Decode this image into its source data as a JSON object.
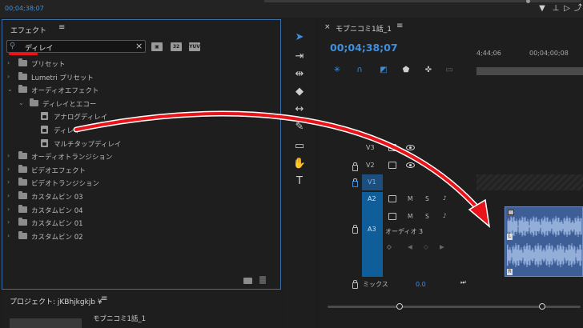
{
  "top": {
    "timecode": "00;04;38;07"
  },
  "effects": {
    "title": "エフェクト",
    "menu": "≡",
    "search_value": "ディレイ",
    "tree": [
      {
        "label": "プリセット",
        "level": 0,
        "kind": "folder",
        "expanded": false
      },
      {
        "label": "Lumetri プリセット",
        "level": 0,
        "kind": "folder",
        "expanded": false
      },
      {
        "label": "オーディオエフェクト",
        "level": 0,
        "kind": "folder",
        "expanded": true
      },
      {
        "label": "ディレイとエコー",
        "level": 1,
        "kind": "folder",
        "expanded": true
      },
      {
        "label": "アナログディレイ",
        "level": 2,
        "kind": "effect"
      },
      {
        "label": "ディレイ",
        "level": 2,
        "kind": "effect"
      },
      {
        "label": "マルチタップディレイ",
        "level": 2,
        "kind": "effect"
      },
      {
        "label": "オーディオトランジション",
        "level": 0,
        "kind": "folder",
        "expanded": false
      },
      {
        "label": "ビデオエフェクト",
        "level": 0,
        "kind": "folder",
        "expanded": false
      },
      {
        "label": "ビデオトランジション",
        "level": 0,
        "kind": "folder",
        "expanded": false
      },
      {
        "label": "カスタムビン 03",
        "level": 0,
        "kind": "folder",
        "expanded": false
      },
      {
        "label": "カスタムビン 04",
        "level": 0,
        "kind": "folder",
        "expanded": false
      },
      {
        "label": "カスタムビン 01",
        "level": 0,
        "kind": "folder",
        "expanded": false
      },
      {
        "label": "カスタムビン 02",
        "level": 0,
        "kind": "folder",
        "expanded": false
      }
    ]
  },
  "project": {
    "title": "プロジェクト: jKBhjkgkjb ¥",
    "menu": "≡",
    "item": "モブニコミ1話_1"
  },
  "timeline": {
    "close": "×",
    "title": "モブニコミ1話_1",
    "menu": "≡",
    "timecode": "00;04;38;07",
    "ruler_left": "4;44;06",
    "ruler_right": "00;04;00;08",
    "tracks": {
      "v3": "V3",
      "v2": "V2",
      "v1": "V1",
      "a2": "A2",
      "a3": "A3",
      "m": "M",
      "s": "S",
      "a3_name": "オーディオ 3",
      "mix": "ミックス",
      "mix_value": "0.0"
    },
    "clip": {
      "left": "L",
      "right": "R"
    }
  },
  "colors": {
    "accent": "#3f8fe0",
    "clip": "#3d5e96",
    "annotation": "#e8141a"
  }
}
